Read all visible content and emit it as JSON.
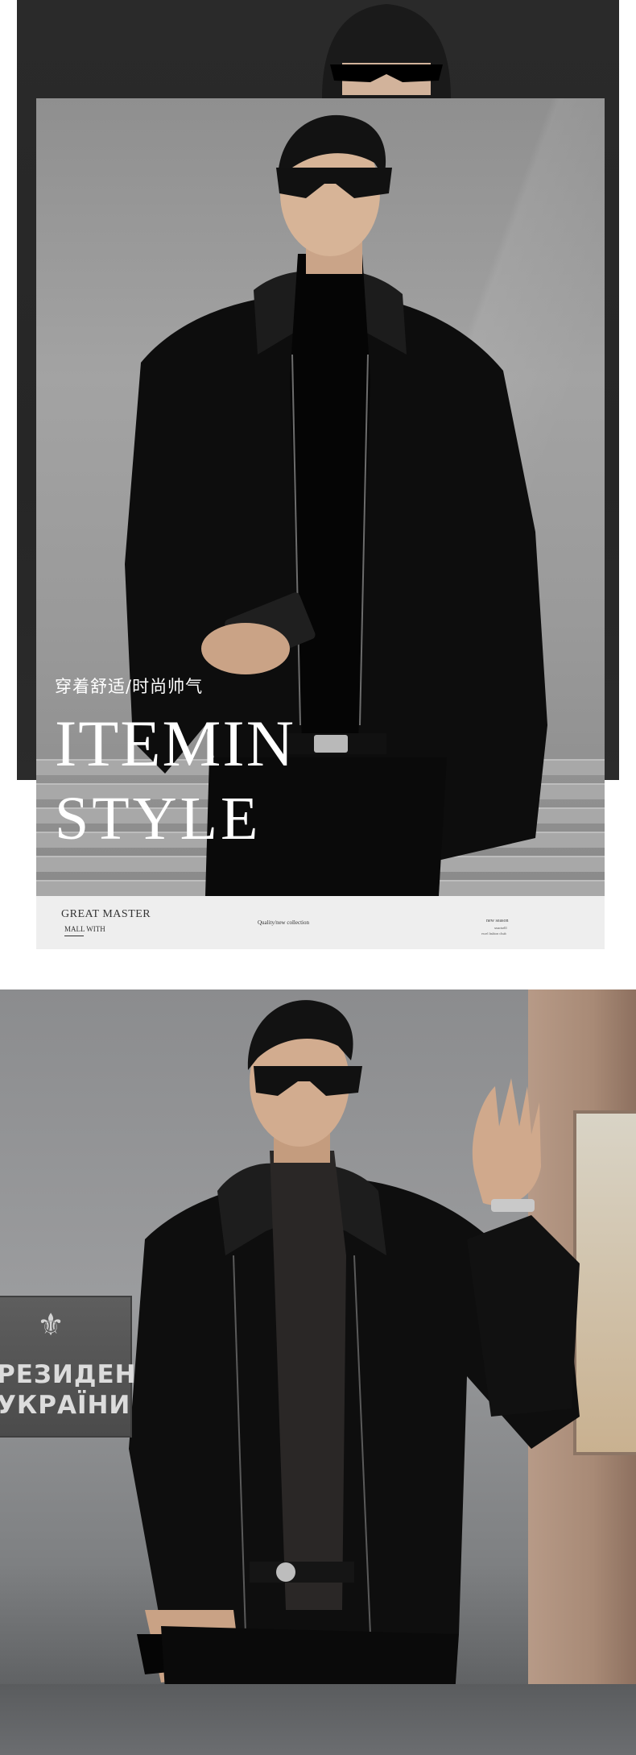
{
  "hero": {
    "subtitle": "穿着舒适/时尚帅气",
    "title_line1": "ITEMIN",
    "title_line2": "STYLE"
  },
  "caption_bar": {
    "brand_line1": "GREAT MASTER",
    "brand_line2": "MALL WITH",
    "center_text": "Quality/new collection",
    "right_line1": "new season",
    "right_line2": "smartselll",
    "right_line3": "excel fashion clsub"
  },
  "sign": {
    "line1": "РЕЗИДЕН",
    "line2": "УКРАЇНИ",
    "emblem_icon": "trident-emblem-icon"
  },
  "palette": {
    "background": "#ffffff",
    "dark_frame": "#2a2a2a",
    "caption_bar": "#eeeeee",
    "title_text": "#ffffff"
  }
}
